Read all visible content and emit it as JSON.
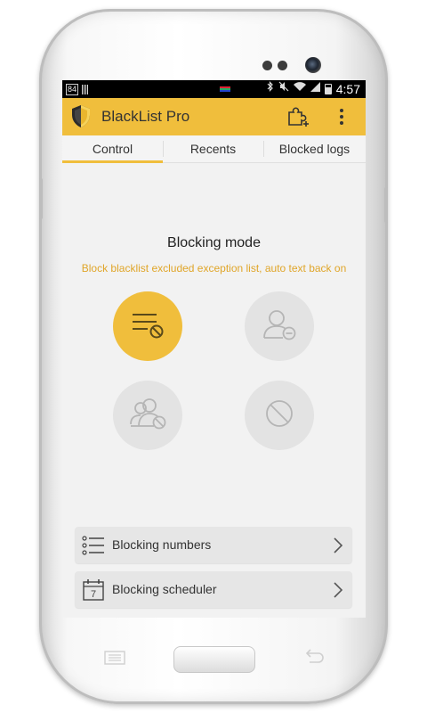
{
  "status_bar": {
    "left_badge": "84",
    "time": "4:57"
  },
  "app_bar": {
    "title": "BlackList Pro",
    "logo_icon": "shield-icon",
    "addon_icon": "puzzle-add-icon",
    "overflow_icon": "more-vertical-icon",
    "accent": "#f0be3c"
  },
  "tabs": [
    {
      "label": "Control",
      "active": true
    },
    {
      "label": "Recents",
      "active": false
    },
    {
      "label": "Blocked logs",
      "active": false
    }
  ],
  "blocking_mode": {
    "title": "Blocking mode",
    "description": "Block blacklist excluded exception list, auto text back on",
    "modes": [
      {
        "icon": "blacklist-block-icon",
        "active": true
      },
      {
        "icon": "contact-remove-icon",
        "active": false
      },
      {
        "icon": "contacts-block-icon",
        "active": false
      },
      {
        "icon": "block-all-icon",
        "active": false
      }
    ]
  },
  "menu_items": [
    {
      "label": "Blocking numbers",
      "icon": "list-icon"
    },
    {
      "label": "Blocking scheduler",
      "icon": "calendar-icon",
      "calendar_day": "7"
    }
  ]
}
